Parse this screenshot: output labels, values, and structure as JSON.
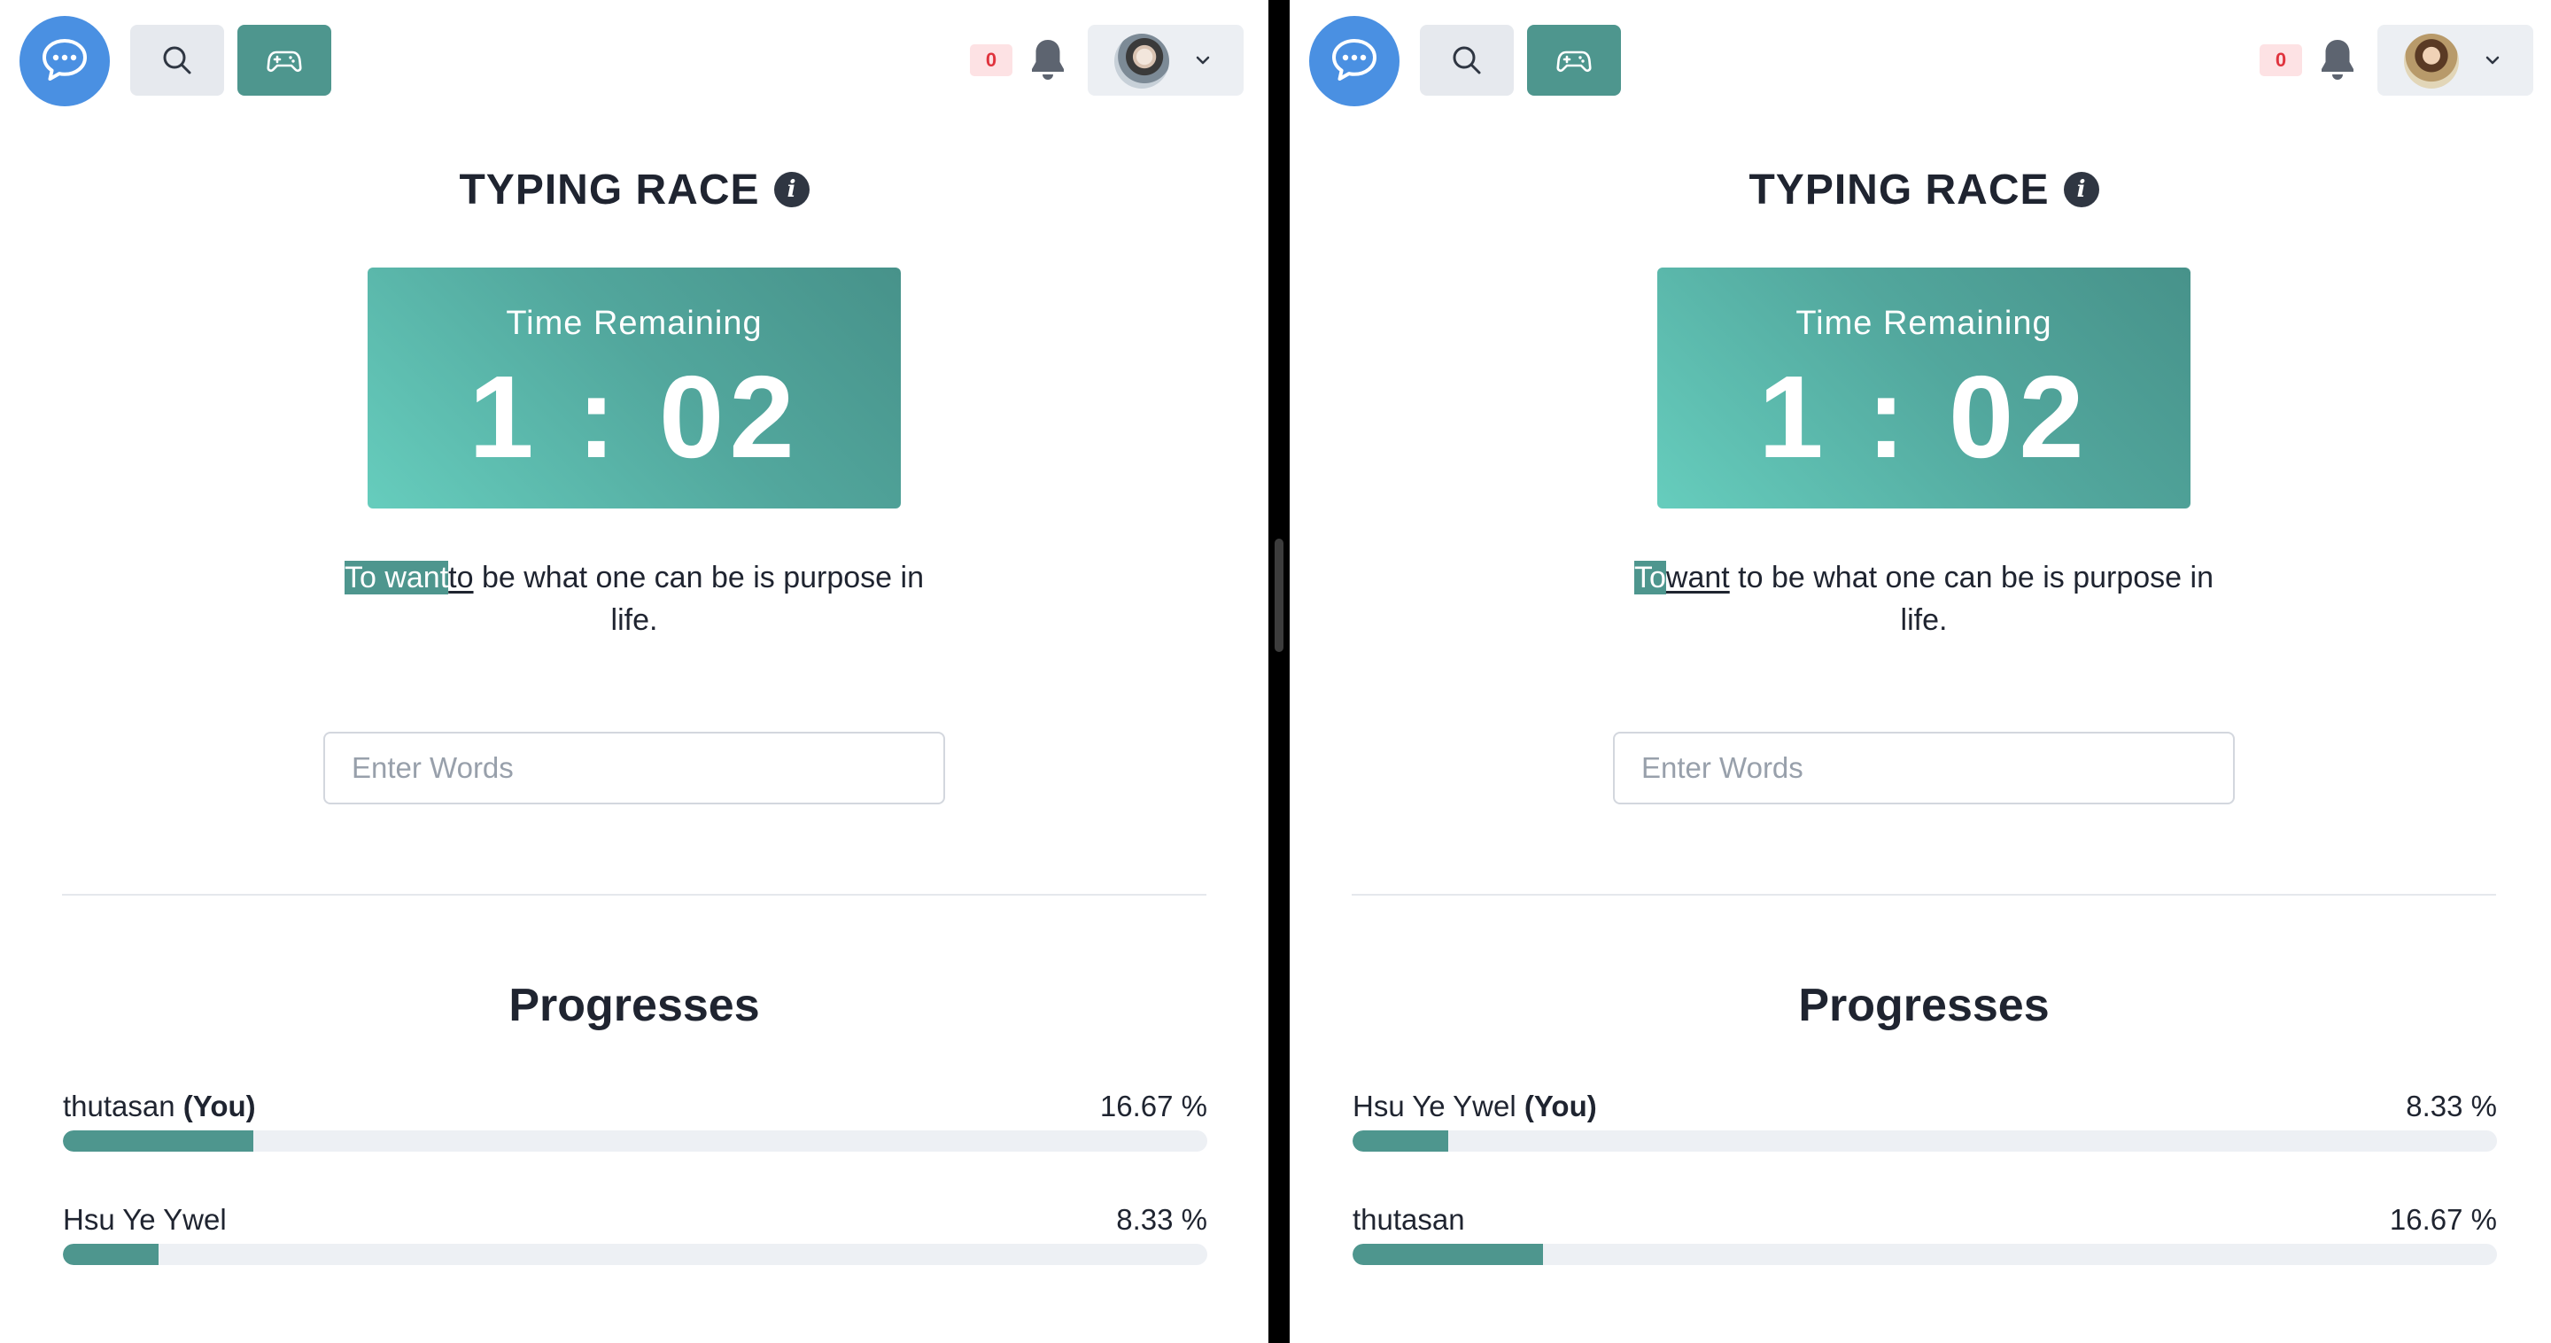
{
  "panes": [
    {
      "navbar": {
        "notification_count": "0",
        "avatar": "user-avatar-thutasan"
      },
      "game": {
        "title": "TYPING RACE",
        "timer": {
          "label": "Time Remaining",
          "value": "1 : 02"
        },
        "sentence": {
          "typed": "To want",
          "current": "to",
          "rest": " be what one can be is purpose in life."
        },
        "input": {
          "placeholder": "Enter Words",
          "value": ""
        }
      },
      "progress": {
        "title": "Progresses",
        "players": [
          {
            "name": "thutasan",
            "you_tag": "(You)",
            "percent_text": "16.67 %",
            "percent": 16.67
          },
          {
            "name": "Hsu Ye Ywel",
            "you_tag": "",
            "percent_text": "8.33 %",
            "percent": 8.33
          }
        ]
      }
    },
    {
      "navbar": {
        "notification_count": "0",
        "avatar": "user-avatar-hsu-ye-ywel"
      },
      "game": {
        "title": "TYPING RACE",
        "timer": {
          "label": "Time Remaining",
          "value": "1 : 02"
        },
        "sentence": {
          "typed": "To",
          "current": "want",
          "rest": " to be what one can be is purpose in life."
        },
        "input": {
          "placeholder": "Enter Words",
          "value": ""
        }
      },
      "progress": {
        "title": "Progresses",
        "players": [
          {
            "name": "Hsu Ye Ywel",
            "you_tag": "(You)",
            "percent_text": "8.33 %",
            "percent": 8.33
          },
          {
            "name": "thutasan",
            "you_tag": "",
            "percent_text": "16.67 %",
            "percent": 16.67
          }
        ]
      }
    }
  ],
  "colors": {
    "brand_blue": "#4a90e2",
    "accent_teal": "#4e968e",
    "timer_gradient_start": "#66cdbd",
    "timer_gradient_end": "#47928a",
    "badge_bg": "#fde2e4",
    "badge_text": "#e0343e"
  },
  "icons": {
    "logo": "chat-bubble-icon",
    "search": "search-icon",
    "game": "gamepad-icon",
    "notifications": "bell-icon",
    "menu": "chevron-down-icon",
    "info": "info-icon"
  }
}
